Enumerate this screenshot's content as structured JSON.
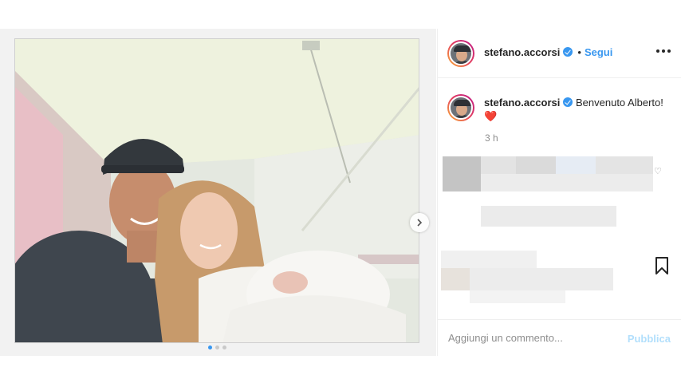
{
  "post": {
    "username": "stefano.accorsi",
    "follow_label": "Segui",
    "bullet": "•",
    "caption_text": "Benvenuto Alberto!",
    "caption_emoji": "❤️",
    "time_ago": "3 h",
    "comment_placeholder": "Aggiungi un commento...",
    "publish_label": "Pubblica"
  },
  "icons": {
    "verified": "verified-badge-icon",
    "more": "more-options-icon",
    "next": "chevron-right-icon",
    "bookmark": "bookmark-icon",
    "like": "heart-icon"
  },
  "colors": {
    "link_blue": "#3897f0",
    "publish_disabled": "#b2dffc",
    "heart_red": "#ed4956"
  },
  "carousel": {
    "total": 3,
    "active": 1
  }
}
